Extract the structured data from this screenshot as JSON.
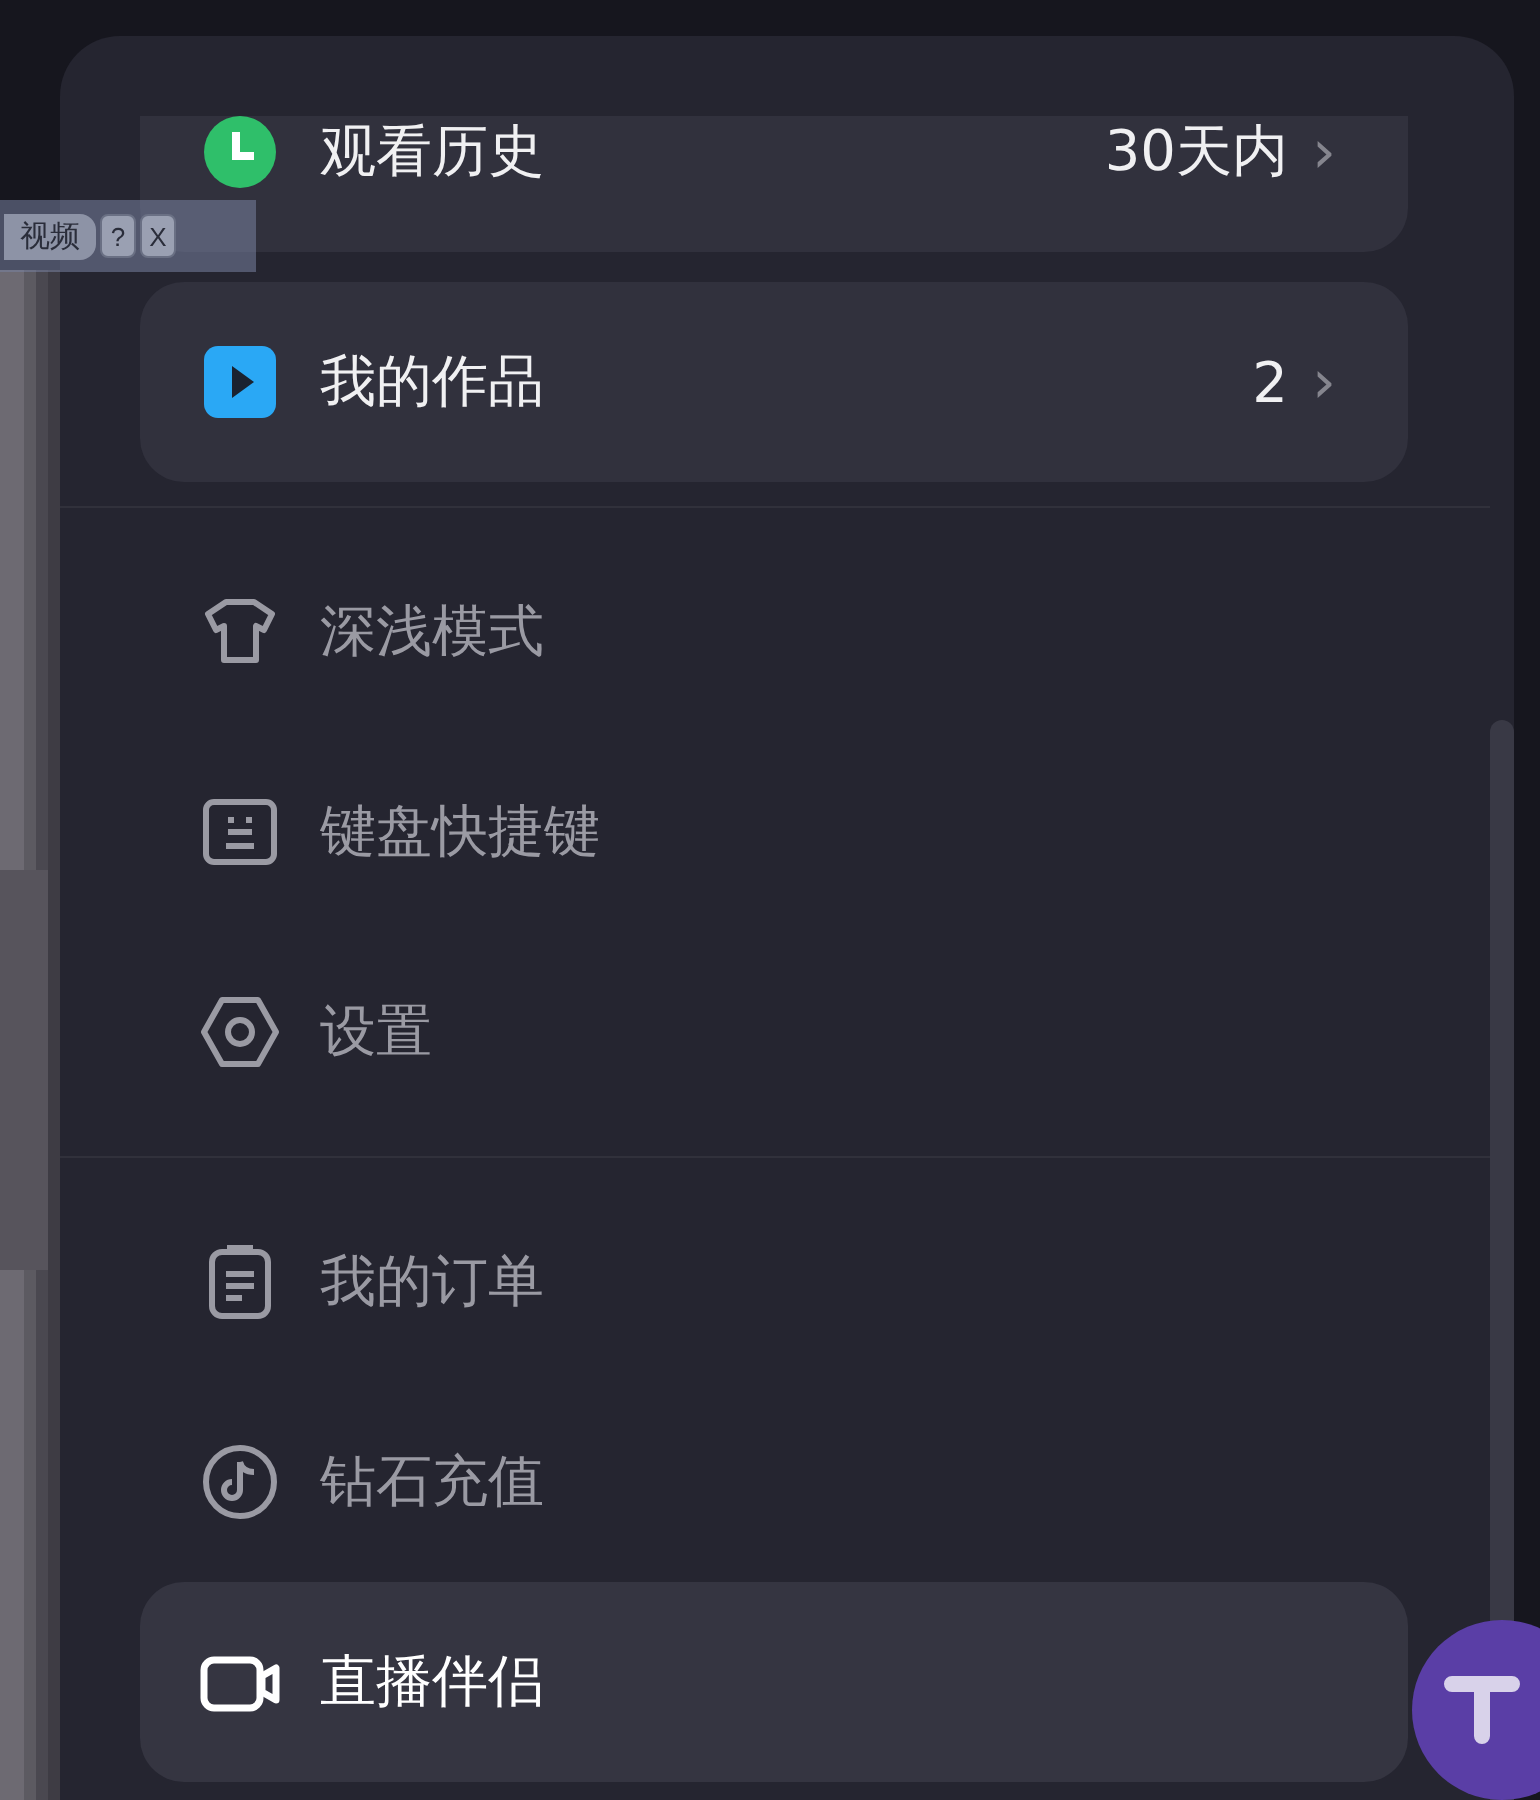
{
  "toolbar": {
    "title": "视频",
    "buttons": [
      "?",
      "X"
    ]
  },
  "sections": [
    {
      "items": [
        {
          "kind": "card",
          "label": "观看历史",
          "value": "30天内",
          "chevron": "›"
        },
        {
          "kind": "card",
          "label": "我的作品",
          "value": "2",
          "chevron": "›"
        }
      ]
    },
    {
      "items": [
        {
          "kind": "plain",
          "label": "深浅模式",
          "selected": false
        },
        {
          "kind": "plain",
          "label": "键盘快捷键",
          "selected": false
        },
        {
          "kind": "plain",
          "label": "设置",
          "selected": false
        }
      ]
    },
    {
      "items": [
        {
          "kind": "plain",
          "label": "我的订单",
          "selected": false
        },
        {
          "kind": "plain",
          "label": "钻石充值",
          "selected": false
        },
        {
          "kind": "plain",
          "label": "直播伴侣",
          "selected": true
        }
      ]
    }
  ]
}
